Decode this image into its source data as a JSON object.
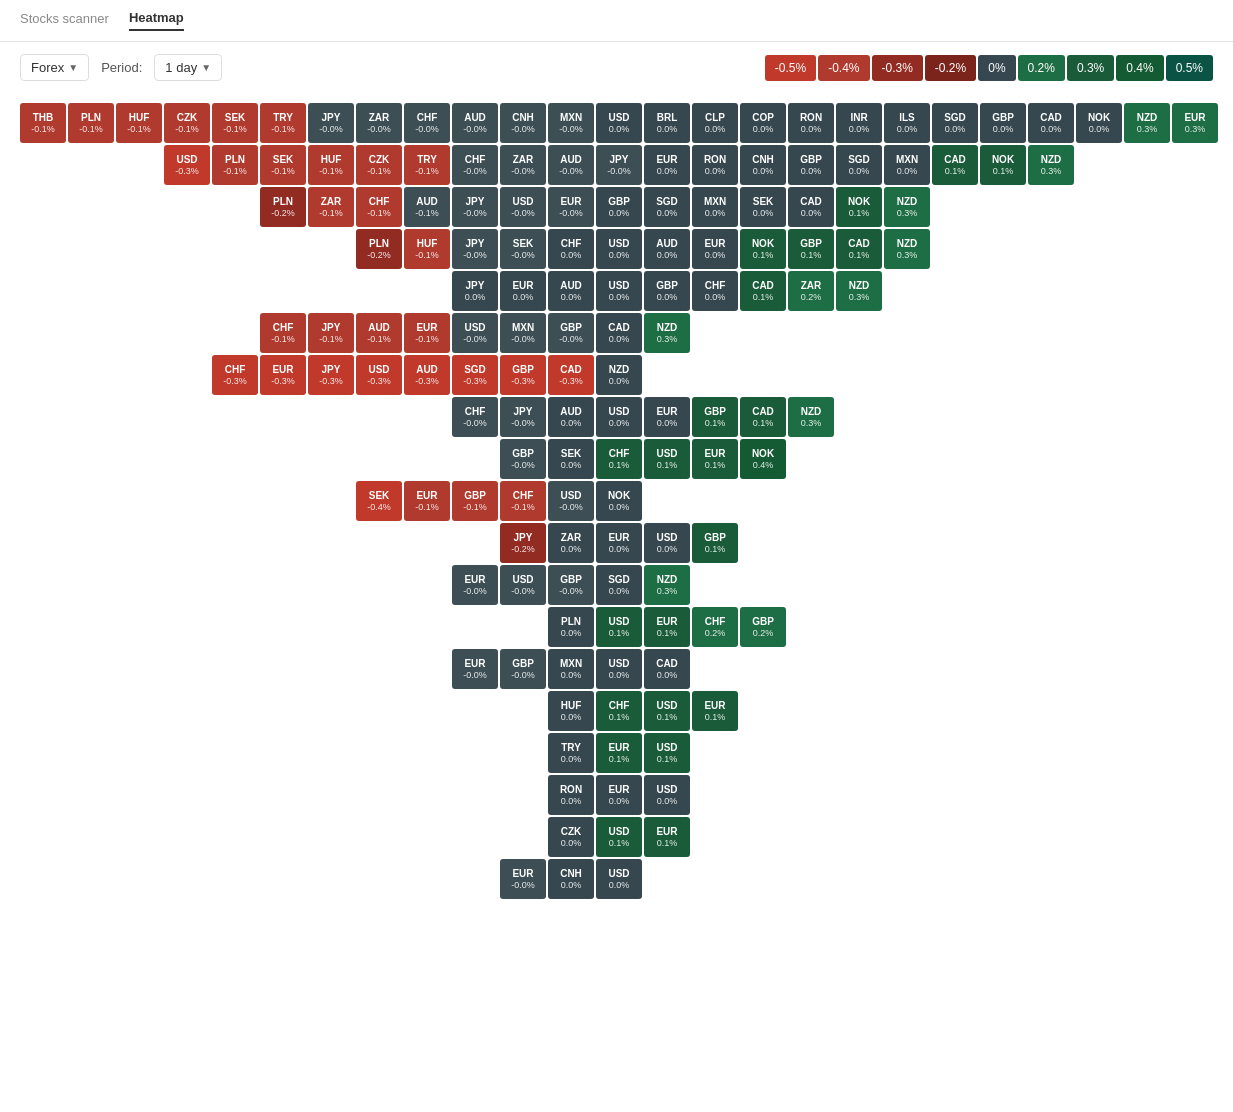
{
  "nav": {
    "tabs": [
      {
        "label": "Stocks scanner",
        "active": false
      },
      {
        "label": "Heatmap",
        "active": true
      }
    ]
  },
  "controls": {
    "market": "Forex",
    "market_arrow": "▼",
    "period_label": "Period:",
    "period": "1 day",
    "period_arrow": "▼"
  },
  "legend": {
    "items": [
      {
        "label": "-0.5%",
        "color": "#c0392b"
      },
      {
        "label": "-0.4%",
        "color": "#b03a2e"
      },
      {
        "label": "-0.3%",
        "color": "#922b21"
      },
      {
        "label": "-0.2%",
        "color": "#7b241c"
      },
      {
        "label": "0%",
        "color": "#37474f"
      },
      {
        "label": "0.2%",
        "color": "#1e6e45"
      },
      {
        "label": "0.3%",
        "color": "#1a5c3a"
      },
      {
        "label": "0.4%",
        "color": "#145a32"
      },
      {
        "label": "0.5%",
        "color": "#0b5345"
      }
    ]
  }
}
